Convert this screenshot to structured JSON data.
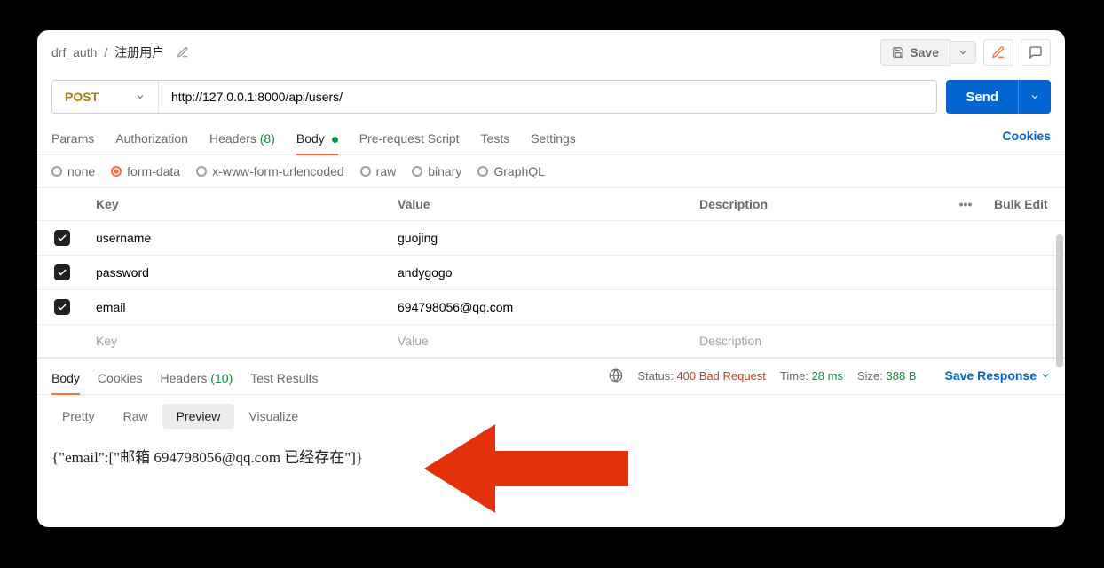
{
  "breadcrumb": {
    "parent": "drf_auth",
    "sep": "/",
    "current": "注册用户"
  },
  "topbar": {
    "save_label": "Save"
  },
  "request": {
    "method": "POST",
    "url": "http://127.0.0.1:8000/api/users/",
    "send_label": "Send"
  },
  "tabs": {
    "params": "Params",
    "authorization": "Authorization",
    "headers": "Headers",
    "headers_count": "(8)",
    "body": "Body",
    "prerequest": "Pre-request Script",
    "tests": "Tests",
    "settings": "Settings",
    "cookies": "Cookies"
  },
  "body_types": {
    "none": "none",
    "formdata": "form-data",
    "xform": "x-www-form-urlencoded",
    "raw": "raw",
    "binary": "binary",
    "graphql": "GraphQL"
  },
  "form_table": {
    "head_key": "Key",
    "head_value": "Value",
    "head_desc": "Description",
    "bulk_edit": "Bulk Edit",
    "rows": [
      {
        "key": "username",
        "value": "guojing",
        "desc": ""
      },
      {
        "key": "password",
        "value": "andygogo",
        "desc": ""
      },
      {
        "key": "email",
        "value": "694798056@qq.com",
        "desc": ""
      }
    ],
    "placeholder_key": "Key",
    "placeholder_value": "Value",
    "placeholder_desc": "Description"
  },
  "response_tabs": {
    "body": "Body",
    "cookies": "Cookies",
    "headers": "Headers",
    "headers_count": "(10)",
    "test_results": "Test Results",
    "save_response": "Save Response"
  },
  "status": {
    "status_label": "Status:",
    "status_value": "400 Bad Request",
    "time_label": "Time:",
    "time_value": "28 ms",
    "size_label": "Size:",
    "size_value": "388 B"
  },
  "view_modes": {
    "pretty": "Pretty",
    "raw": "Raw",
    "preview": "Preview",
    "visualize": "Visualize"
  },
  "response_body": "{\"email\":[\"邮箱 694798056@qq.com 已经存在\"]}"
}
